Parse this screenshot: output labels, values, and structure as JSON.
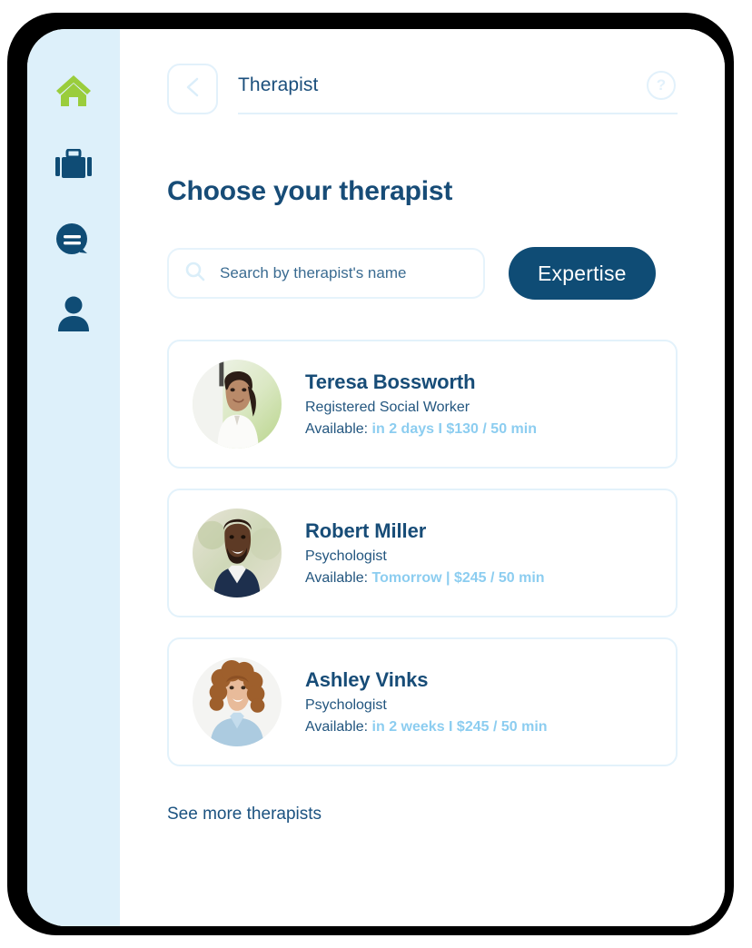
{
  "sidebar": {
    "items": [
      {
        "icon": "home-icon",
        "name": "home",
        "active": true
      },
      {
        "icon": "briefcase-icon",
        "name": "work",
        "active": false
      },
      {
        "icon": "chat-bubble-icon",
        "name": "messages",
        "active": false
      },
      {
        "icon": "person-icon",
        "name": "profile",
        "active": false
      }
    ],
    "active_color": "#9ACD3C",
    "inactive_color": "#0f4c75",
    "background": "#ddf0fa"
  },
  "header": {
    "back_label": "chevron-left-icon",
    "title": "Therapist",
    "help_label": "?"
  },
  "page": {
    "title": "Choose your therapist"
  },
  "search": {
    "placeholder": "Search by therapist's name",
    "value": "",
    "icon": "search-icon"
  },
  "expertise_button": {
    "label": "Expertise",
    "color": "#0f4c75"
  },
  "therapists": [
    {
      "name": "Teresa Bossworth",
      "role": "Registered Social Worker",
      "available_label": "Available:",
      "available_value": "in 2 days I $130 / 50 min",
      "avatar": "photo-woman-dark-hair"
    },
    {
      "name": "Robert Miller",
      "role": "Psychologist",
      "available_label": "Available:",
      "available_value": "Tomorrow | $245 / 50 min",
      "avatar": "photo-man-beard"
    },
    {
      "name": "Ashley Vinks",
      "role": "Psychologist",
      "available_label": "Available:",
      "available_value": "in 2 weeks I $245 / 50 min",
      "avatar": "photo-woman-curly-hair"
    }
  ],
  "see_more": {
    "label": "See more therapists"
  },
  "colors": {
    "navy": "#174c77",
    "light_blue": "#8ccdf0",
    "border": "#e3f2fb",
    "sidebar_bg": "#ddf0fa",
    "green": "#9ACD3C"
  }
}
